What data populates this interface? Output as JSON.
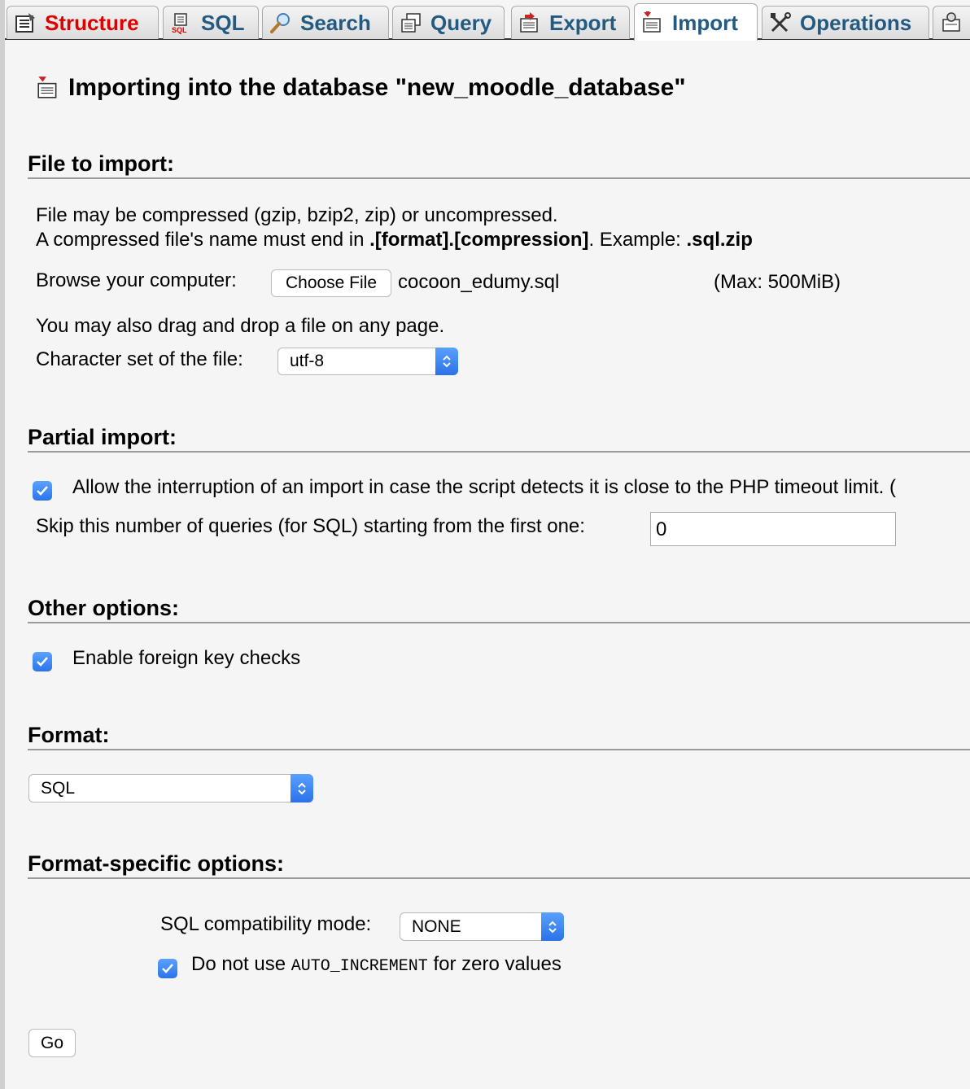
{
  "tabs": [
    {
      "label": "Structure",
      "icon": "table-structure-icon"
    },
    {
      "label": "SQL",
      "icon": "sql-icon"
    },
    {
      "label": "Search",
      "icon": "magnifier-icon"
    },
    {
      "label": "Query",
      "icon": "query-icon"
    },
    {
      "label": "Export",
      "icon": "export-icon"
    },
    {
      "label": "Import",
      "icon": "import-icon",
      "active": true
    },
    {
      "label": "Operations",
      "icon": "tools-icon"
    },
    {
      "label": "",
      "icon": "privileges-icon"
    }
  ],
  "page": {
    "title": "Importing into the database \"new_moodle_database\""
  },
  "file_section": {
    "heading": "File to import:",
    "note_line1": "File may be compressed (gzip, bzip2, zip) or uncompressed.",
    "note_line2_prefix": "A compressed file's name must end in ",
    "note_line2_bold": ".[format].[compression]",
    "note_line2_mid": ". Example: ",
    "note_line2_example": ".sql.zip",
    "browse_label": "Browse your computer:",
    "choose_file_label": "Choose File",
    "chosen_file": "cocoon_edumy.sql",
    "max_size": "(Max: 500MiB)",
    "drag_note": "You may also drag and drop a file on any page.",
    "charset_label": "Character set of the file:",
    "charset_value": "utf-8"
  },
  "partial_section": {
    "heading": "Partial import:",
    "allow_interrupt_label": "Allow the interruption of an import in case the script detects it is close to the PHP timeout limit. (",
    "allow_interrupt_checked": true,
    "skip_label": "Skip this number of queries (for SQL) starting from the first one:",
    "skip_value": "0"
  },
  "other_section": {
    "heading": "Other options:",
    "fk_label": "Enable foreign key checks",
    "fk_checked": true
  },
  "format_section": {
    "heading": "Format:",
    "format_value": "SQL"
  },
  "format_specific": {
    "heading": "Format-specific options:",
    "compat_label": "SQL compatibility mode:",
    "compat_value": "NONE",
    "auto_inc_prefix": "Do not use ",
    "auto_inc_code": "AUTO_INCREMENT",
    "auto_inc_suffix": " for zero values",
    "auto_inc_checked": true
  },
  "actions": {
    "go_label": "Go"
  },
  "colors": {
    "tab_text": "#235a81",
    "active_tab_accent": "#dd0000",
    "checkbox": "#2b73ea",
    "background": "#f5f5f5"
  }
}
